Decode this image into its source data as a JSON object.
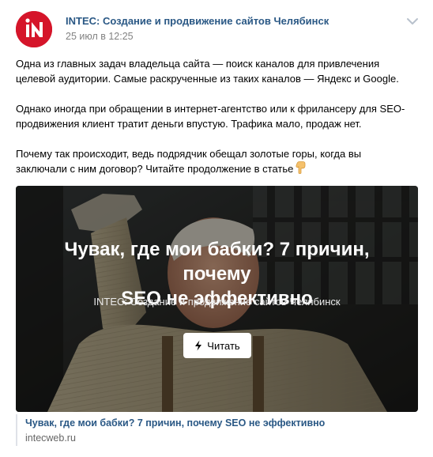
{
  "post": {
    "author": "INTEC: Создание и продвижение сайтов Челябинск",
    "date": "25 июл в 12:25",
    "text": {
      "p1_line1": "Одна из главных задач владельца сайта — поиск каналов для привлечения",
      "p1_line2": "целевой аудитории. Самые раскрученные из таких каналов — Яндекс и Google.",
      "p2_line1": "Однако иногда при обращении в интернет-агентство или к фрилансеру для SEO-",
      "p2_line2": "продвижения клиент тратит деньги впустую. Трафика мало, продаж нет.",
      "p3_line1": "Почему так происходит, ведь подрядчик обещал золотые горы, когда вы",
      "p3_line2": "заключали с ним договор? Читайте продолжение в статье"
    },
    "icons": {
      "avatar": "intec-logo-icon",
      "menu": "chevron-down-icon",
      "emoji": "pointing-down-hand-icon",
      "button": "lightning-icon"
    },
    "colors": {
      "brand": "#d5152a",
      "link": "#2a5885"
    }
  },
  "snippet": {
    "title_line1": "Чувак, где мои бабки? 7 причин, почему",
    "title_line2": "SEO не эффективно",
    "site": "INTEC: Создание и продвижение сайтов Челябинск",
    "button_label": "Читать"
  },
  "link": {
    "title": "Чувак, где мои бабки? 7 причин, почему SEO не эффективно",
    "domain": "intecweb.ru"
  }
}
